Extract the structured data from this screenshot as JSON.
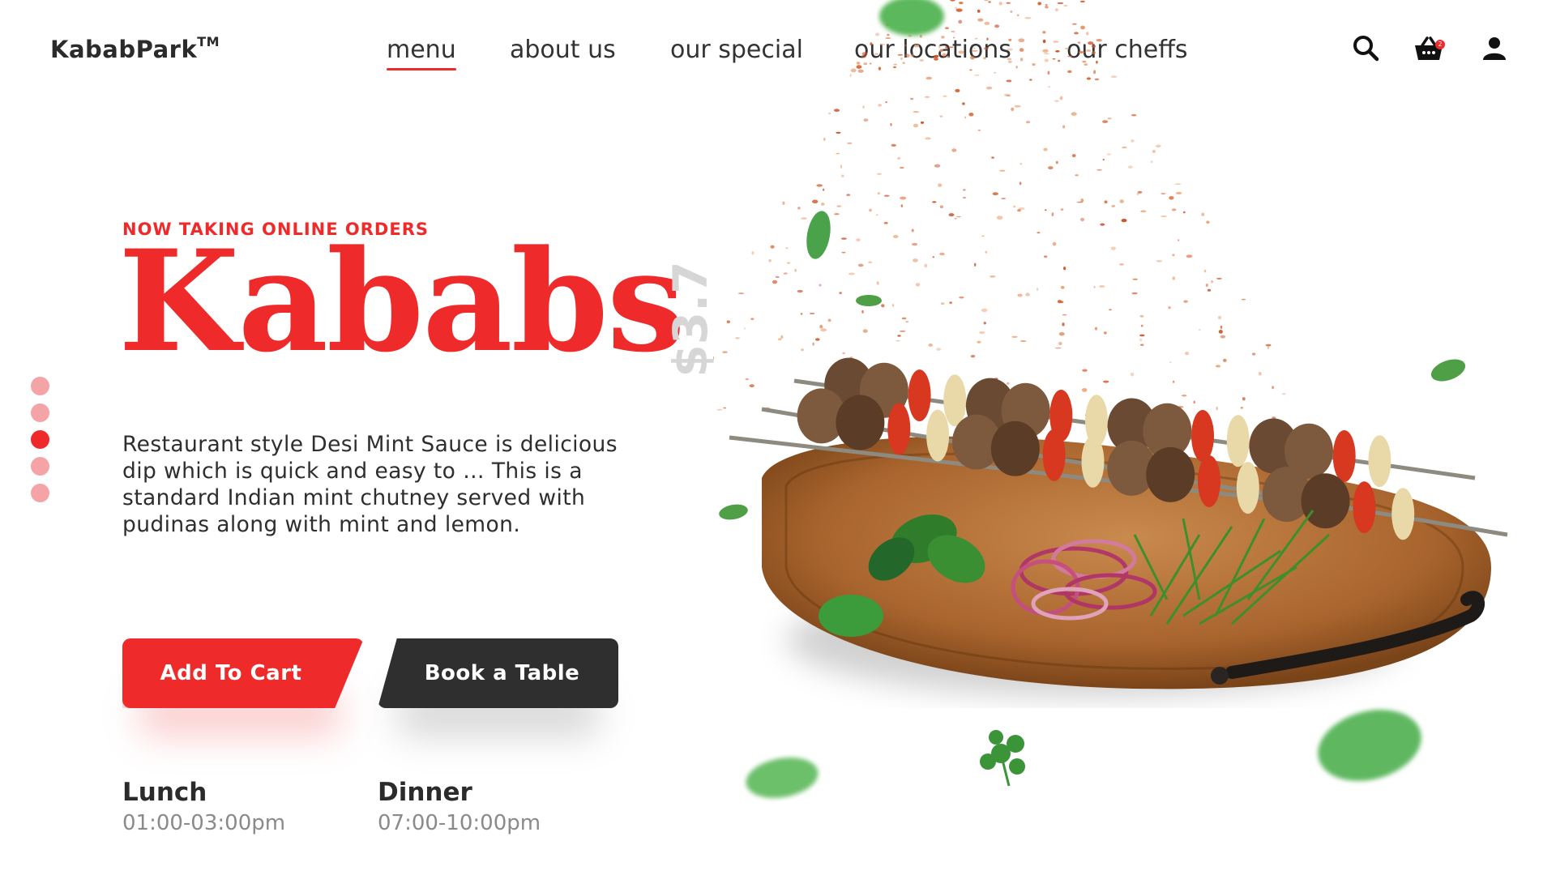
{
  "brand": {
    "name": "KababPark",
    "trademark": "TM"
  },
  "nav": {
    "items": [
      {
        "label": "menu",
        "active": true
      },
      {
        "label": "about us",
        "active": false
      },
      {
        "label": "our special",
        "active": false
      },
      {
        "label": "our locations",
        "active": false
      },
      {
        "label": "our cheffs",
        "active": false
      }
    ]
  },
  "header_icons": {
    "search": "search-icon",
    "cart": "basket-icon",
    "cart_badge": "2",
    "account": "user-icon"
  },
  "hero": {
    "eyebrow": "NOW TAKING ONLINE ORDERS",
    "title": "Kababs",
    "price": "$3.7",
    "description": "Restaurant style Desi Mint Sauce is delicious dip which is quick and easy to … This is a standard Indian mint chutney served with pudinas along with mint and lemon.",
    "slider": {
      "count": 5,
      "active_index": 2
    }
  },
  "actions": {
    "add_to_cart": "Add To Cart",
    "book_table": "Book a Table"
  },
  "hours": [
    {
      "label": "Lunch",
      "time": "01:00-03:00pm"
    },
    {
      "label": "Dinner",
      "time": "07:00-10:00pm"
    }
  ],
  "colors": {
    "accent": "#ee2a2a",
    "dark_button": "#2f2f2f",
    "dot_inactive": "#f4a4a6",
    "price": "#d6d6d6"
  }
}
